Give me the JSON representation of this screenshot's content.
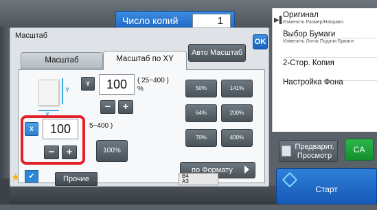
{
  "header": {
    "copies_label": "Число копий",
    "copies_value": "1"
  },
  "right_panel": {
    "items": [
      {
        "title": "Оригинал",
        "subtitle": "Изменить Размер/Направл."
      },
      {
        "title": "Выбор Бумаги",
        "subtitle": "Изменить Лоток Подачи Бумаги"
      },
      {
        "title": "2-Стор. Копия",
        "subtitle": ""
      },
      {
        "title": "Настройка Фона",
        "subtitle": ""
      }
    ]
  },
  "actions": {
    "preview_label_line1": "Предварит.",
    "preview_label_line2": "Просмотр",
    "ca_label": "CA",
    "start_label": "Старт"
  },
  "dialog": {
    "title": "Масштаб",
    "ok_label": "OK",
    "tabs": [
      {
        "label": "Масштаб",
        "active": false
      },
      {
        "label": "Масштаб по XY",
        "active": true
      }
    ],
    "auto_scale_label": "Авто Масштаб",
    "axis_y": {
      "tag": "Y",
      "value": "100",
      "range": "( 25~400 )",
      "unit": "%"
    },
    "axis_x": {
      "tag": "X",
      "value": "100",
      "range": "5~400 )"
    },
    "icon_y_label": "Y",
    "icon_x_label": "X",
    "minus_label": "−",
    "plus_label": "+",
    "presets": [
      "50%",
      "141%",
      "64%",
      "200%",
      "70%",
      "400%"
    ],
    "hundred_label": "100%",
    "by_format_label": "по Формату"
  },
  "bottom_bar": {
    "other_label": "Прочие",
    "tray_line1": "B4",
    "tray_line2": "A3"
  },
  "colors": {
    "accent_blue": "#1e66c4",
    "ca_green": "#13902e",
    "highlight_red": "#e3212b",
    "icon_cyan": "#3da7e0"
  }
}
